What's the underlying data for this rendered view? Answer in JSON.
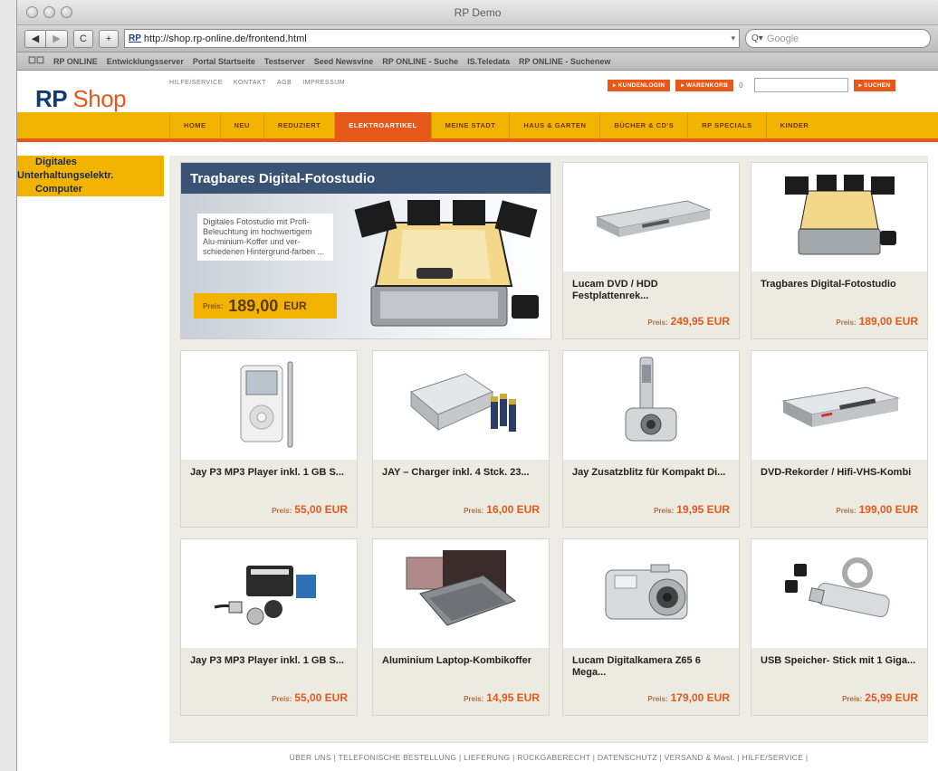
{
  "window": {
    "title": "RP Demo"
  },
  "toolbar": {
    "back_label": "◀",
    "forward_label": "▶",
    "reload_label": "C",
    "add_label": "+",
    "url_favicon": "RP",
    "url": "http://shop.rp-online.de/frontend.html",
    "search_placeholder": "Google",
    "search_prefix": "Q▾"
  },
  "bookmarks": [
    "RP ONLINE",
    "Entwicklungsserver",
    "Portal Startseite",
    "Testserver",
    "Seed Newsvine",
    "RP ONLINE - Suche",
    "IS.Teledata",
    "RP ONLINE - Suchenew"
  ],
  "header": {
    "logo_rp": "RP",
    "logo_shop": "Shop",
    "links": [
      "HILFE/SERVICE",
      "KONTAKT",
      "AGB",
      "IMPRESSUM"
    ],
    "kundenlogin": "▸ KUNDENLOGIN",
    "warenkorb": "▸ WARENKORB",
    "cart_count": "0",
    "search_button": "▸ SUCHEN"
  },
  "nav": [
    {
      "label": "HOME",
      "active": false
    },
    {
      "label": "NEU",
      "active": false
    },
    {
      "label": "REDUZIERT",
      "active": false
    },
    {
      "label": "ELEKTROARTIKEL",
      "active": true
    },
    {
      "label": "MEINE STADT",
      "active": false
    },
    {
      "label": "HAUS & GARTEN",
      "active": false
    },
    {
      "label": "BÜCHER & CD'S",
      "active": false
    },
    {
      "label": "RP SPECIALS",
      "active": false
    },
    {
      "label": "KINDER",
      "active": false
    }
  ],
  "sidebar": [
    {
      "label": "Digitales",
      "shift": false
    },
    {
      "label": "Unterhaltungselektr.",
      "shift": true
    },
    {
      "label": "Computer",
      "shift": false
    }
  ],
  "feature": {
    "title": "Tragbares Digital-Fotostudio",
    "description": "Digitales Fotostudio mit Profi-Beleuchtung im hochwertigem Alu-minium-Koffer und ver-schiedenen Hintergrund-farben ...",
    "price_label": "Preis:",
    "price": "189,00",
    "currency": "EUR"
  },
  "price_label": "Preis:",
  "products": [
    {
      "name": "Lucam DVD / HDD Festplattenrek...",
      "price": "249,95 EUR",
      "icon": "dvd-recorder-icon"
    },
    {
      "name": "Tragbares Digital-Fotostudio",
      "price": "189,00 EUR",
      "icon": "photo-studio-icon"
    },
    {
      "name": "Jay P3 MP3 Player inkl. 1 GB S...",
      "price": "55,00 EUR",
      "icon": "mp3-player-icon"
    },
    {
      "name": "JAY – Charger inkl. 4 Stck. 23...",
      "price": "16,00 EUR",
      "icon": "battery-charger-icon"
    },
    {
      "name": "Jay Zusatzblitz für Kompakt Di...",
      "price": "19,95 EUR",
      "icon": "camera-flash-icon"
    },
    {
      "name": "DVD-Rekorder / Hifi-VHS-Kombi",
      "price": "199,00 EUR",
      "icon": "vhs-dvd-combo-icon"
    },
    {
      "name": "Jay P3 MP3 Player inkl. 1 GB S...",
      "price": "55,00 EUR",
      "icon": "camera-accessories-icon"
    },
    {
      "name": "Aluminium Laptop-Kombikoffer",
      "price": "14,95 EUR",
      "icon": "laptop-case-icon"
    },
    {
      "name": "Lucam Digitalkamera Z65 6 Mega...",
      "price": "179,00 EUR",
      "icon": "digital-camera-icon"
    },
    {
      "name": "USB Speicher- Stick mit 1 Giga...",
      "price": "25,99 EUR",
      "icon": "usb-stick-icon"
    }
  ],
  "footer": "ÜBER UNS | TELEFONISCHE BESTELLUNG | LIEFERUNG | RÜCKGABERECHT | DATENSCHUTZ | VERSAND & Mwst. | HILFE/SERVICE |"
}
